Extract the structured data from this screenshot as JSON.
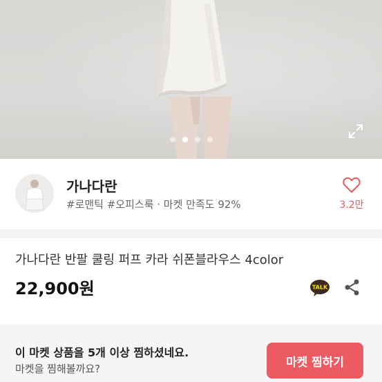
{
  "gallery": {
    "dots": [
      false,
      true,
      false,
      false
    ],
    "expand_icon": "expand-icon"
  },
  "seller": {
    "name": "가나다란",
    "tags": "#로맨틱 #오피스룩 · 마켓 만족도 92%",
    "like_count": "3.2만",
    "like_icon": "heart-outline-icon"
  },
  "product": {
    "title": "가나다란 반팔 쿨링 퍼프 카라 쉬폰블라우스 4color",
    "price": "22,900원",
    "talk_label": "TALK"
  },
  "bottom_bar": {
    "message": "이 마켓 상품을 5개 이상 찜하셨네요.",
    "sub_message": "마켓을 찜해볼까요?",
    "cta_label": "마켓 찜하기"
  },
  "colors": {
    "accent": "#ec5a62",
    "like": "#e8585b",
    "kakao_talk": "#3c2a1e"
  }
}
